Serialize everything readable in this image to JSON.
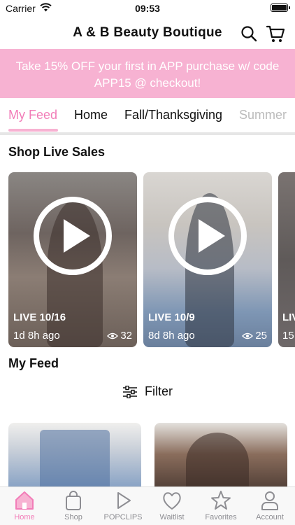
{
  "status_bar": {
    "carrier": "Carrier",
    "time": "09:53"
  },
  "header": {
    "title": "A & B Beauty Boutique",
    "icons": [
      "search-icon",
      "cart-icon"
    ]
  },
  "promo": {
    "text": "Take 15% OFF your first in APP purchase w/ code APP15 @ checkout!"
  },
  "tabs": [
    {
      "label": "My Feed",
      "active": true
    },
    {
      "label": "Home"
    },
    {
      "label": "Fall/Thanksgiving"
    },
    {
      "label": "Summer"
    }
  ],
  "live_sales": {
    "title": "Shop Live Sales",
    "cards": [
      {
        "label": "LIVE 10/16",
        "ago": "1d 8h ago",
        "views": "32"
      },
      {
        "label": "LIVE 10/9",
        "ago": "8d 8h ago",
        "views": "25"
      },
      {
        "label": "LIV",
        "ago": "15"
      }
    ]
  },
  "feed": {
    "title": "My Feed",
    "filter_label": "Filter"
  },
  "tab_bar": {
    "items": [
      {
        "label": "Home",
        "icon": "home-icon",
        "active": true
      },
      {
        "label": "Shop",
        "icon": "bag-icon"
      },
      {
        "label": "POPCLIPS",
        "icon": "play-icon"
      },
      {
        "label": "Waitlist",
        "icon": "heart-icon"
      },
      {
        "label": "Favorites",
        "icon": "star-icon"
      },
      {
        "label": "Account",
        "icon": "person-icon"
      }
    ]
  },
  "colors": {
    "accent": "#f27db8",
    "promo_bg": "#f7b2d2",
    "inactive": "#8e8e93"
  }
}
